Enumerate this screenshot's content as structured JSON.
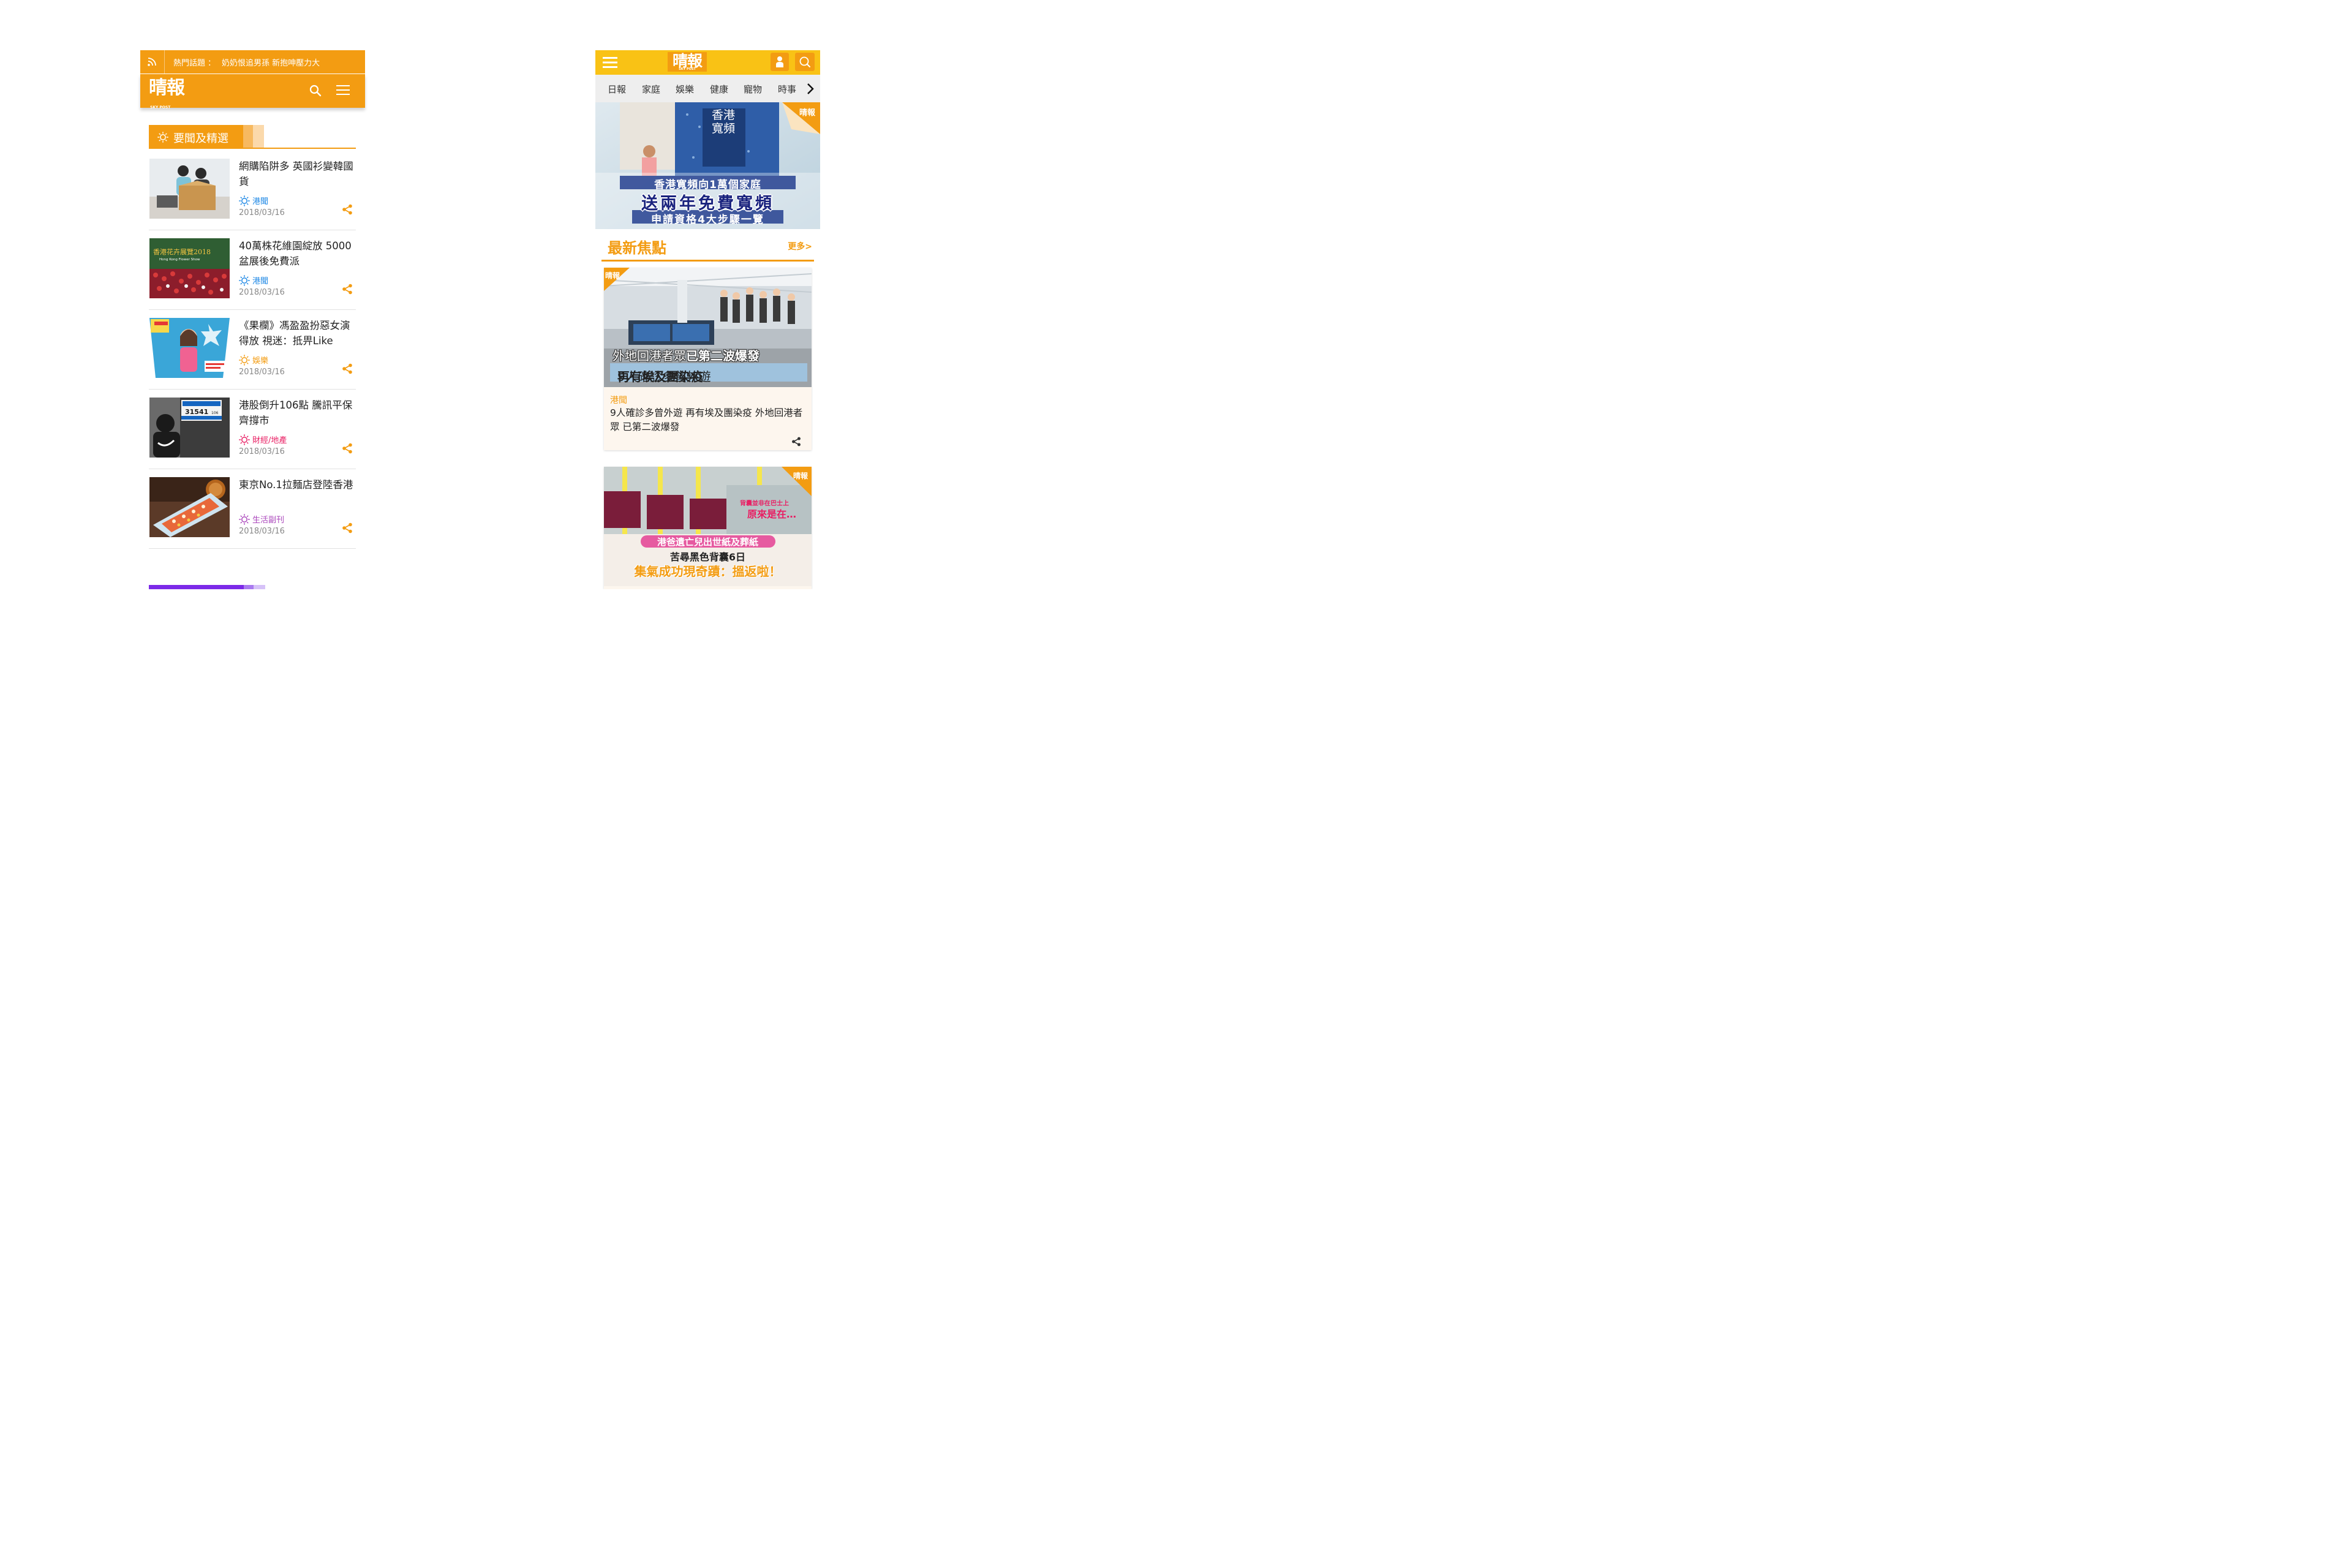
{
  "left_app": {
    "topbar": {
      "hot_label": "熱門話題",
      "colon": "：",
      "hot_text": "奶奶恨追男孫 新抱呻壓力大"
    },
    "brand": {
      "name": "晴報",
      "sub": "SKY POST"
    },
    "section_title": "要聞及精選",
    "news": [
      {
        "title": "網購陷阱多 英國衫變韓國貨",
        "category": "港聞",
        "date": "2018/03/16",
        "cat_color": "#1e88e5",
        "thumb": "online-shopping-icon"
      },
      {
        "title": "40萬株花維園綻放 5000盆展後免費派",
        "category": "港聞",
        "date": "2018/03/16",
        "cat_color": "#1e88e5",
        "thumb": "flower-show-icon",
        "thumb_text": "香港花卉展覽2018",
        "thumb_sub": "Hong Kong Flower Show"
      },
      {
        "title": "《果欄》馮盈盈扮惡女演得放 視迷：抵畀Like",
        "category": "娛樂",
        "date": "2018/03/16",
        "cat_color": "#f39c12",
        "thumb": "drama-poster-icon"
      },
      {
        "title": "港股倒升106點 騰訊平保齊撐市",
        "category": "財經/地產",
        "date": "2018/03/16",
        "cat_color": "#e91e63",
        "thumb": "hang-seng-board-icon",
        "thumb_text": "31541",
        "thumb_sub": "106"
      },
      {
        "title": "東京No.1拉麵店登陸香港",
        "category": "生活副刊",
        "date": "2018/03/16",
        "cat_color": "#ab47bc",
        "thumb": "ramen-dish-icon"
      }
    ]
  },
  "right_app": {
    "brand": {
      "name": "晴報",
      "sub": "SKY POST"
    },
    "categories": [
      "日報",
      "家庭",
      "娛樂",
      "健康",
      "寵物",
      "時事"
    ],
    "banner": {
      "line1": "香港寬頻向1萬個家庭",
      "line2": "送兩年免費寬頻",
      "line3": "申請資格4大步驟一覽",
      "sign": "香港寬頻",
      "corner": "晴報"
    },
    "section": {
      "title": "最新焦點",
      "more": "更多>"
    },
    "cards": [
      {
        "category": "港聞",
        "title": "9人確診多曾外遊 再有埃及團染疫 外地回港者眾 已第二波爆發",
        "overlay1a": "外地回港者眾",
        "overlay1b": "已第二波爆發",
        "overlay2a": "9人確診多曾外遊",
        "overlay2b": "再有埃及團染疫",
        "corner": "晴報"
      },
      {
        "overlay_small": "背囊並非在巴士上",
        "overlay_a": "原來是在…",
        "overlay_b": "港爸遺亡兒出世紙及葬紙",
        "overlay_c": "苦尋黑色背囊6日",
        "overlay_d": "集氣成功現奇蹟：搵返啦！",
        "corner": "晴報"
      }
    ]
  },
  "colors": {
    "orange": "#f39c12",
    "yellow": "#f9c215",
    "purple": "#7c2ae8"
  }
}
